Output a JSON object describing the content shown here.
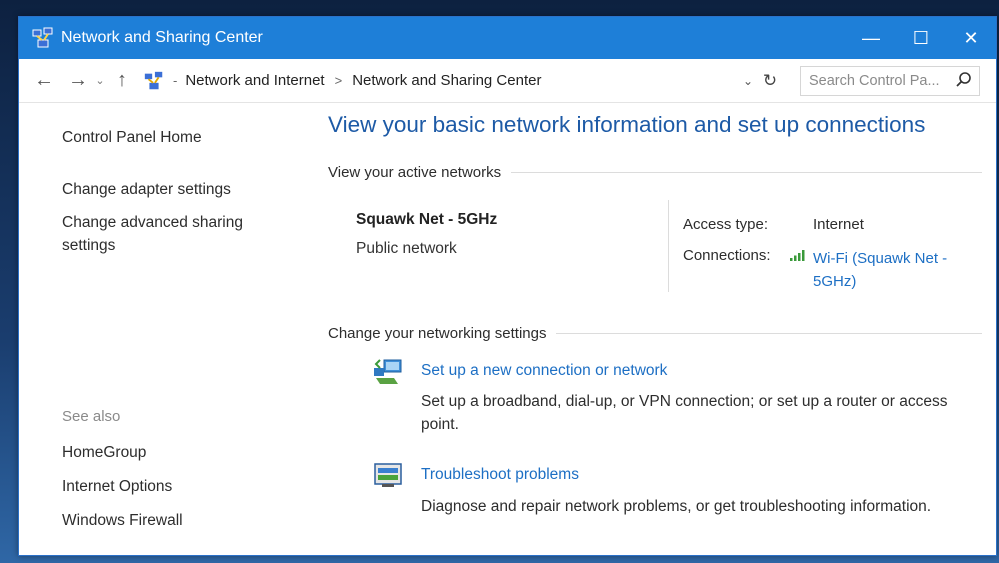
{
  "window": {
    "title": "Network and Sharing Center",
    "controls": {
      "minimize": "—",
      "maximize": "☐",
      "close": "✕"
    }
  },
  "addressbar": {
    "back": "←",
    "forward": "→",
    "recent": "⌄",
    "up": "↑",
    "crumb_sep_start": "-",
    "breadcrumbs": [
      "Network and Internet",
      "Network and Sharing Center"
    ],
    "separator": ">",
    "dropdown": "⌄",
    "refresh": "↻",
    "search_placeholder": "Search Control Pa..."
  },
  "sidebar": {
    "home": "Control Panel Home",
    "links": [
      "Change adapter settings",
      "Change advanced sharing settings"
    ],
    "see_also_caption": "See also",
    "see_also": [
      "HomeGroup",
      "Internet Options",
      "Windows Firewall"
    ]
  },
  "main": {
    "heading": "View your basic network information and set up connections",
    "active_networks_title": "View your active networks",
    "network": {
      "name": "Squawk Net - 5GHz",
      "category": "Public network",
      "access_type_label": "Access type:",
      "access_type_value": "Internet",
      "connections_label": "Connections:",
      "connections_value": "Wi-Fi (Squawk Net - 5GHz)"
    },
    "change_settings_title": "Change your networking settings",
    "tasks": [
      {
        "link": "Set up a new connection or network",
        "description": "Set up a broadband, dial-up, or VPN connection; or set up a router or access point.",
        "icon": "network-connection-icon"
      },
      {
        "link": "Troubleshoot problems",
        "description": "Diagnose and repair network problems, or get troubleshooting information.",
        "icon": "troubleshoot-icon"
      }
    ]
  },
  "colors": {
    "titlebar": "#1e7fd8",
    "link": "#1d6fc4",
    "heading": "#1d5aa6"
  }
}
